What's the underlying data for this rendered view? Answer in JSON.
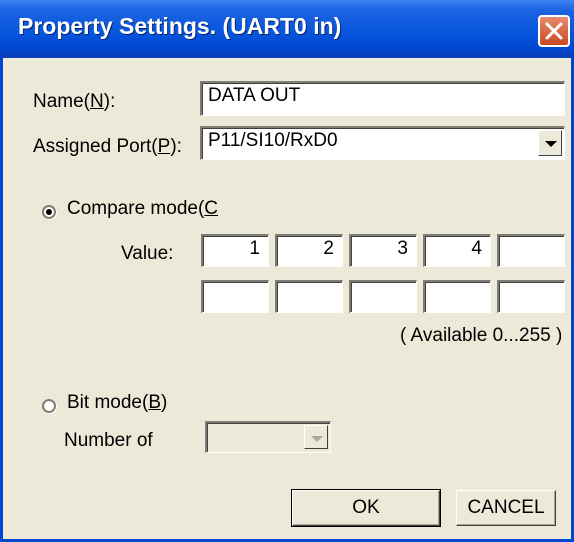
{
  "window": {
    "title": "Property Settings. (UART0 in)"
  },
  "form": {
    "name_label": "Name(",
    "name_key": "N",
    "name_suffix": "):",
    "name_value": "DATA OUT",
    "port_label": "Assigned Port(",
    "port_key": "P",
    "port_suffix": "):",
    "port_value": "P11/SI10/RxD0"
  },
  "compare": {
    "label": "Compare mode(",
    "key": "C",
    "selected": true,
    "value_label": "Value:",
    "values_row1": [
      "1",
      "2",
      "3",
      "4",
      ""
    ],
    "values_row2": [
      "",
      "",
      "",
      "",
      ""
    ],
    "hint": "( Available 0...255 )"
  },
  "bitmode": {
    "label": "Bit mode(",
    "key": "B",
    "suffix": ")",
    "selected": false,
    "count_label": "Number of",
    "count_value": ""
  },
  "buttons": {
    "ok": "OK",
    "cancel": "CANCEL"
  },
  "icons": {
    "close": "close-icon",
    "dropdown": "chevron-down-icon"
  },
  "colors": {
    "titlebar": "#0756de",
    "close_button": "#d75a3a",
    "dialog_bg": "#ece9d8"
  }
}
